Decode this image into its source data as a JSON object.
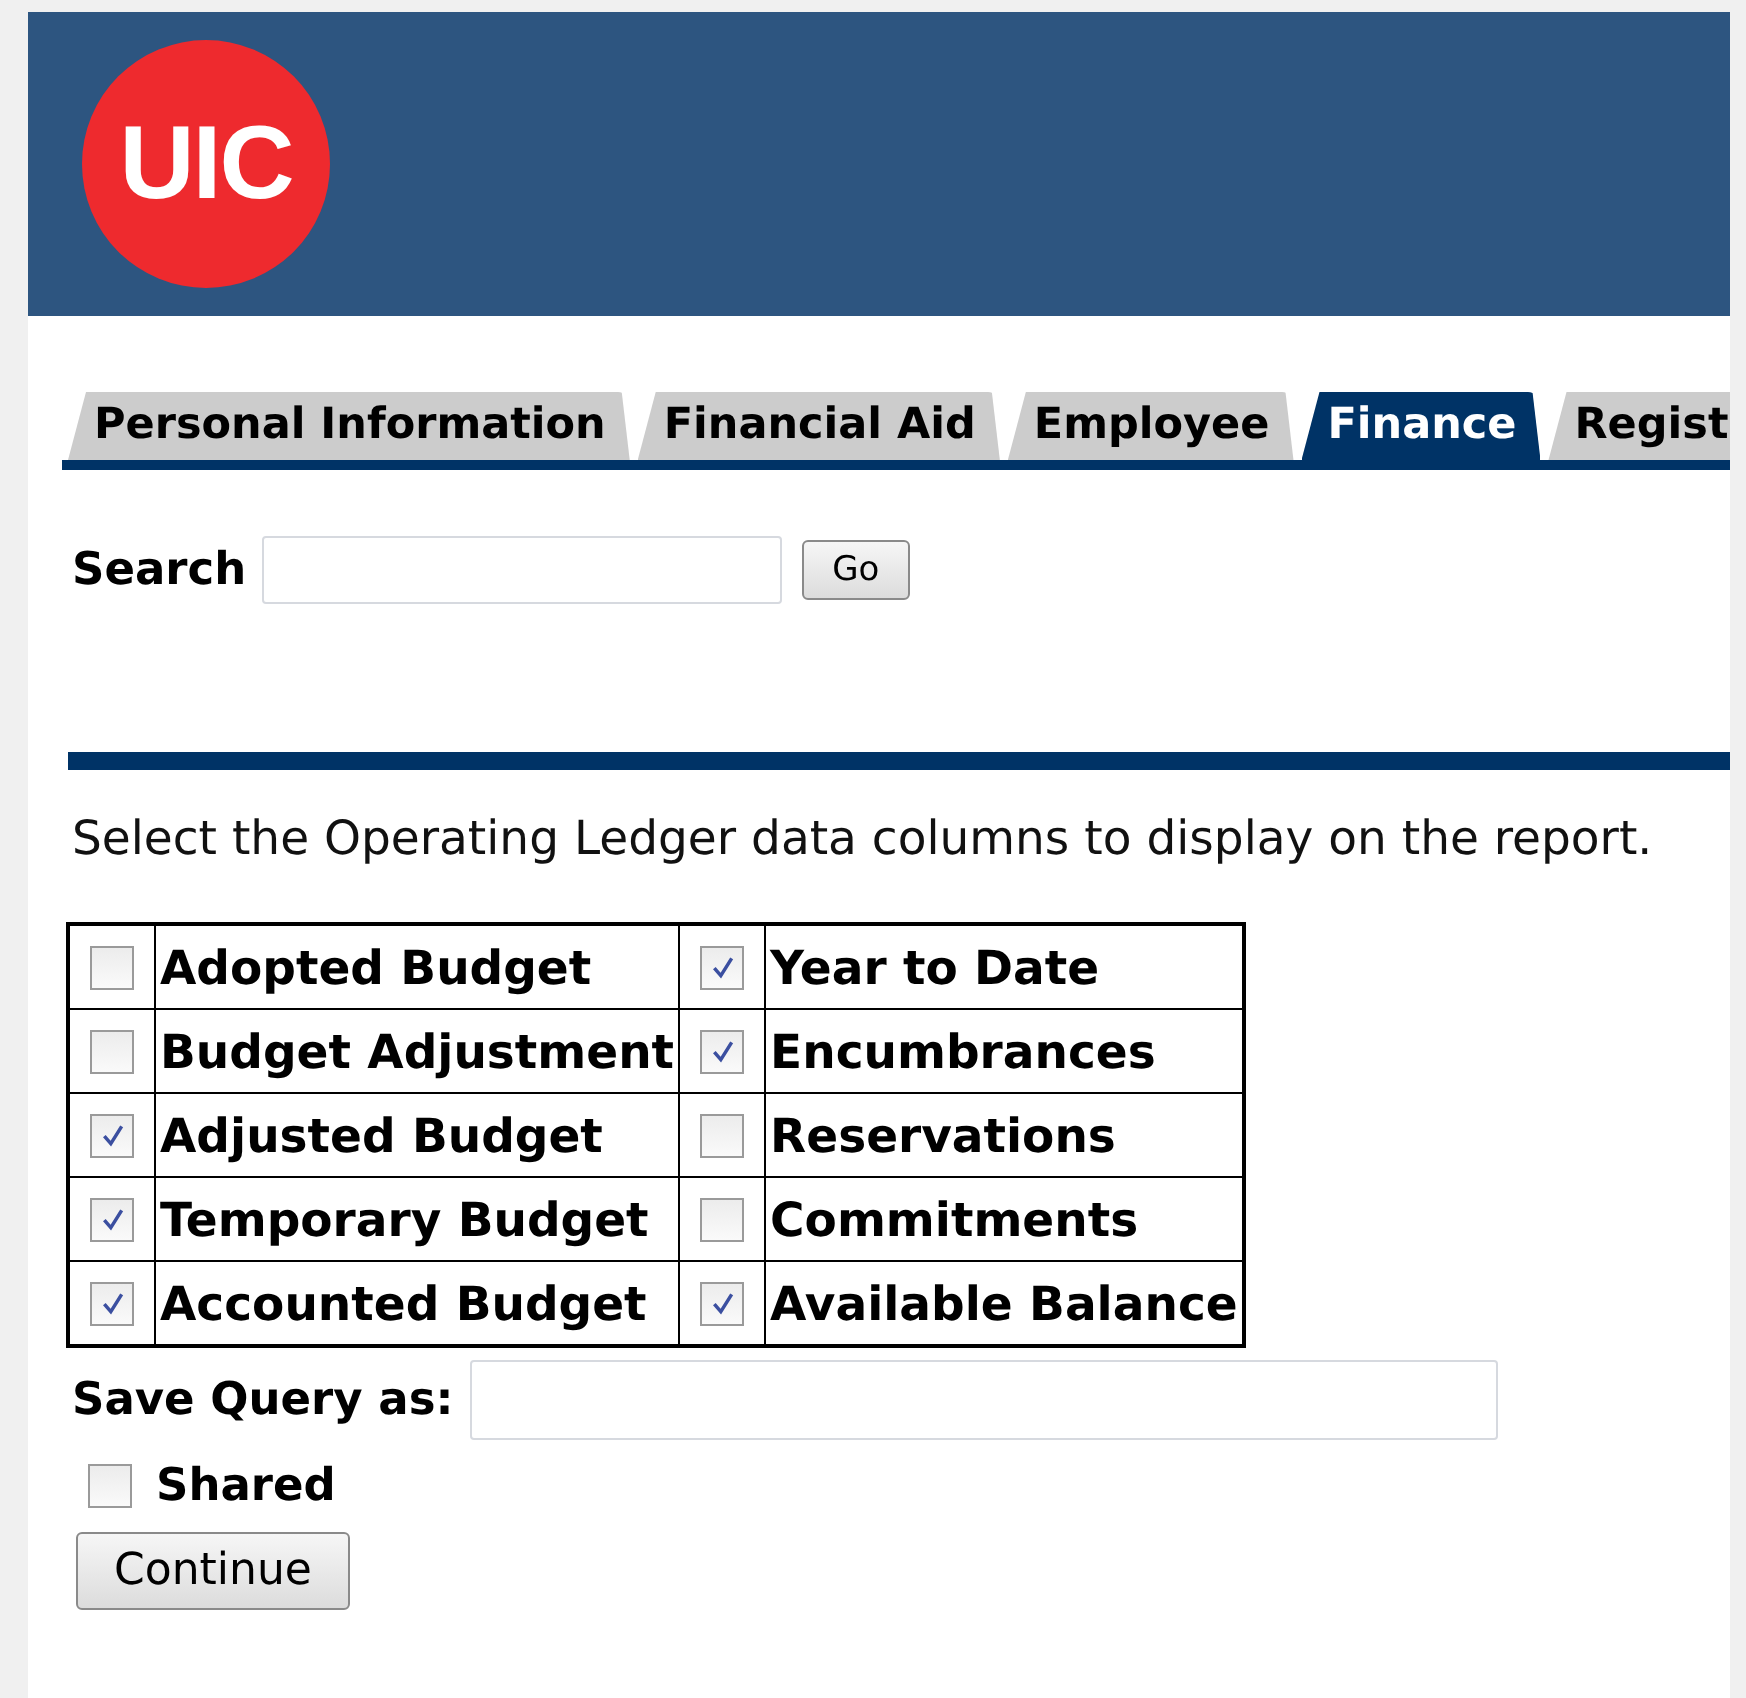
{
  "header": {
    "logo": "UIC"
  },
  "tabs": [
    {
      "label": "Personal Information",
      "selected": false
    },
    {
      "label": "Financial Aid",
      "selected": false
    },
    {
      "label": "Employee",
      "selected": false
    },
    {
      "label": "Finance",
      "selected": true
    },
    {
      "label": "Regist",
      "selected": false
    }
  ],
  "search": {
    "label": "Search",
    "button": "Go"
  },
  "instructions": "Select the Operating Ledger data columns to display on the report.",
  "columns": [
    [
      {
        "label": "Adopted Budget",
        "checked": false
      },
      {
        "label": "Year to Date",
        "checked": true
      }
    ],
    [
      {
        "label": "Budget Adjustment",
        "checked": false
      },
      {
        "label": "Encumbrances",
        "checked": true
      }
    ],
    [
      {
        "label": "Adjusted Budget",
        "checked": true
      },
      {
        "label": "Reservations",
        "checked": false
      }
    ],
    [
      {
        "label": "Temporary Budget",
        "checked": true
      },
      {
        "label": "Commitments",
        "checked": false
      }
    ],
    [
      {
        "label": "Accounted Budget",
        "checked": true
      },
      {
        "label": "Available Balance",
        "checked": true
      }
    ]
  ],
  "save_query": {
    "label": "Save Query as:"
  },
  "shared": {
    "label": "Shared",
    "checked": false
  },
  "continue_button": "Continue"
}
